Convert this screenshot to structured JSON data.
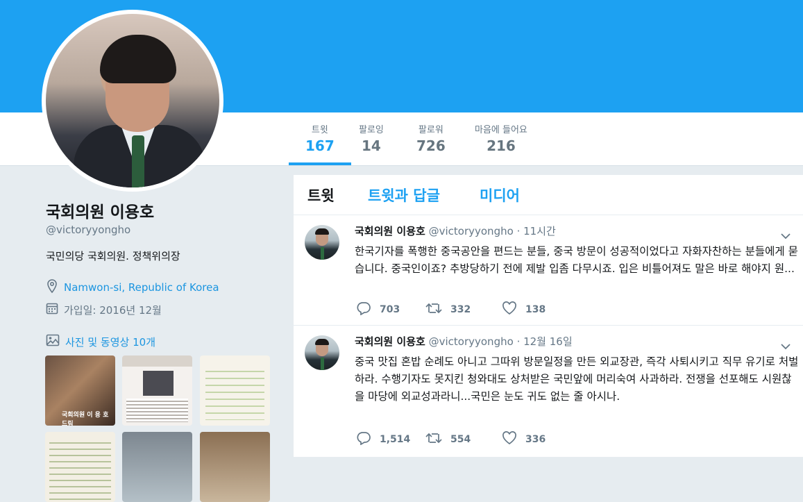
{
  "profile": {
    "name": "국회의원 이용호",
    "handle": "@victoryyongho",
    "bio": "국민의당 국회의원. 정책위의장",
    "location": "Namwon-si, Republic of Korea",
    "joined": "가입일: 2016년 12월",
    "media_link": "사진 및 동영상 10개",
    "media_thumb1_caption": "국회의원 이 용 호 드림"
  },
  "stats": {
    "tweets_label": "트윗",
    "tweets_value": "167",
    "following_label": "팔로잉",
    "following_value": "14",
    "followers_label": "팔로워",
    "followers_value": "726",
    "likes_label": "마음에 들어요",
    "likes_value": "216"
  },
  "tabs": {
    "tweets": "트윗",
    "tweets_replies": "트윗과 답글",
    "media": "미디어"
  },
  "tweets": [
    {
      "name": "국회의원 이용호",
      "handle": "@victoryyongho",
      "time": "· 11시간",
      "text": "한국기자를 폭행한 중국공안을 편드는 분들, 중국 방문이 성공적이었다고 자화자찬하는 분들에게 묻습니다. 중국인이죠? 추방당하기 전에 제발 입좀 다무시죠. 입은 비틀어져도 말은 바로 해야지 원...",
      "replies": "703",
      "retweets": "332",
      "likes": "138"
    },
    {
      "name": "국회의원 이용호",
      "handle": "@victoryyongho",
      "time": "· 12월 16일",
      "text": "중국 맛집 혼밥 순례도 아니고 그따위 방문일정을 만든 외교장관, 즉각 사퇴시키고 직무 유기로 처벌하라. 수행기자도 못지킨 청와대도 상처받은 국민앞에 머리숙여 사과하라. 전쟁을 선포해도 시원찮을 마당에 외교성과라니...국민은 눈도 귀도 없는 줄 아시나.",
      "replies": "1,514",
      "retweets": "554",
      "likes": "336"
    }
  ],
  "colors": {
    "accent": "#1da1f2",
    "background": "#e6ecf0",
    "text": "#14171a",
    "muted": "#657786"
  }
}
